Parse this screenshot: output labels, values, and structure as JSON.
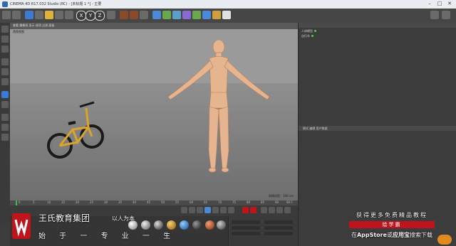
{
  "window": {
    "title": "CINEMA 4D R17.032 Studio (RC) - [未标题 1 *] - 主要",
    "controls": [
      "–",
      "□",
      "✕"
    ]
  },
  "toolbar": {
    "axis_x": "X",
    "axis_y": "Y",
    "axis_z": "Z"
  },
  "viewport": {
    "menu": "查看 摄像机 显示 选项 过滤 面板",
    "label": "透视视图",
    "info": "网格间距：100 cm"
  },
  "timeline": {
    "ticks": [
      "0",
      "5",
      "10",
      "15",
      "20",
      "25",
      "30",
      "35",
      "40",
      "45",
      "50",
      "55",
      "60",
      "65",
      "70",
      "75",
      "80",
      "85",
      "90"
    ],
    "frame_end": "90 F"
  },
  "objects": {
    "rows": [
      "人体模型",
      "自行车"
    ]
  },
  "attributes": {
    "menu": "模式 编辑 用户数据"
  },
  "promo_left": {
    "company": "王氏教育集团",
    "slogan": "以人为本",
    "line2": "始 于 一 专 业 一 生"
  },
  "promo_right": {
    "line1": "获得更多免费精品教程",
    "line2": "绘学霸",
    "line3_a": "在",
    "line3_b": "AppStore",
    "line3_c": "或",
    "line3_d": "应用宝",
    "line3_e": "搜索下载"
  },
  "colors": {
    "accent_red": "#c0141c",
    "skin": "#e6b48e",
    "bike_yellow": "#d9a52a"
  }
}
